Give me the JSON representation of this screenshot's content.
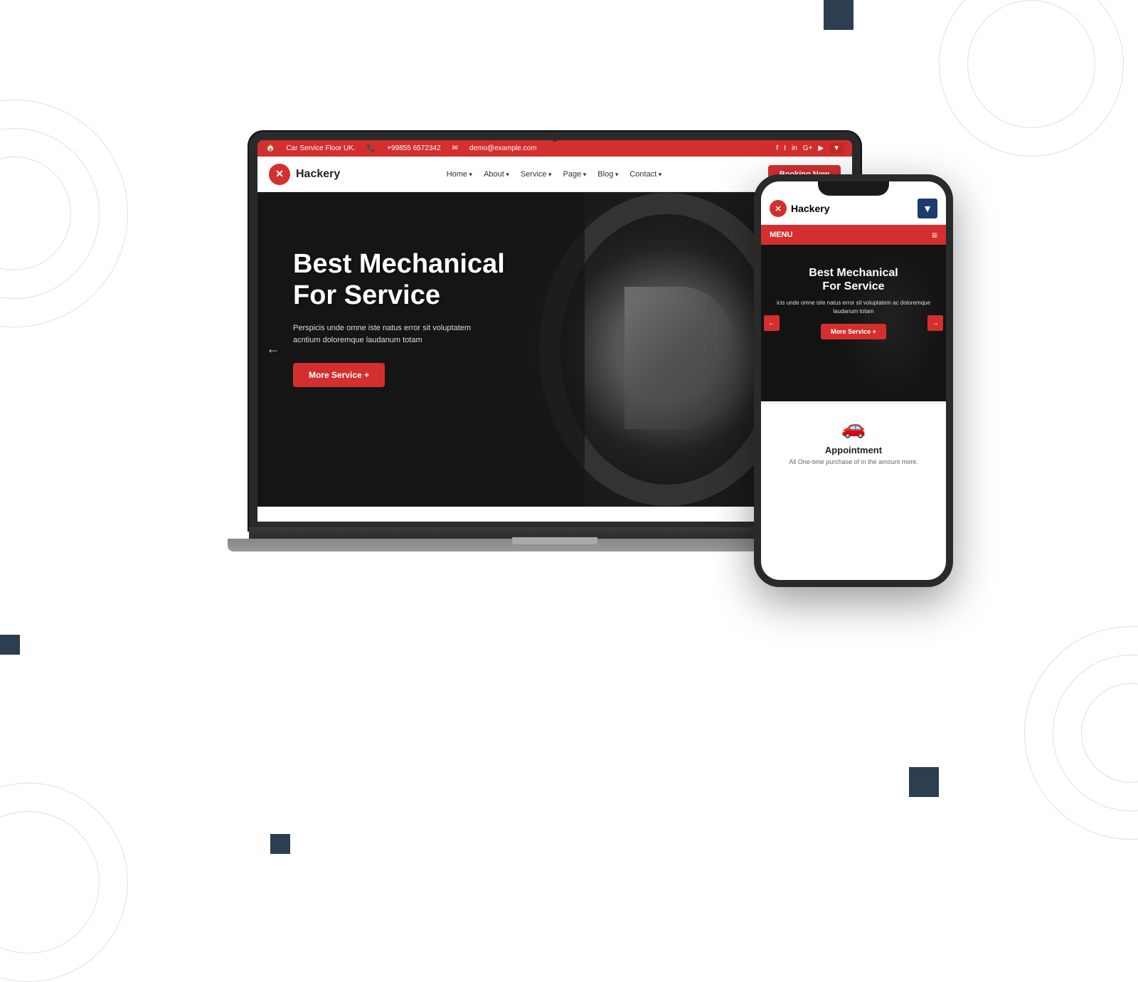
{
  "page": {
    "background": "#ffffff"
  },
  "topbar": {
    "address": "Car Service Floor UK.",
    "phone": "+99855 6572342",
    "email": "demo@example.com",
    "social": [
      "fb",
      "tw",
      "ig",
      "gplus",
      "yt"
    ]
  },
  "nav": {
    "brand": "Hackery",
    "links": [
      {
        "label": "Home",
        "dropdown": true
      },
      {
        "label": "About",
        "dropdown": true
      },
      {
        "label": "Service",
        "dropdown": true
      },
      {
        "label": "Page",
        "dropdown": true
      },
      {
        "label": "Blog",
        "dropdown": true
      },
      {
        "label": "Contact",
        "dropdown": true
      }
    ],
    "booking_btn": "Booking Now"
  },
  "hero": {
    "title_line1": "Best Mechanical",
    "title_line2": "For Service",
    "subtitle": "Perspicis unde omne iste natus error sit voluptatem acntium doloremque laudanum totam",
    "cta_btn": "More Service +",
    "arrow_left": "←",
    "arrow_right": "→"
  },
  "phone": {
    "brand": "Hackery",
    "menu_label": "MENU",
    "hero_title_line1": "Best Mechanical",
    "hero_title_line2": "For Service",
    "hero_text": "icis unde omne iste natus error sit voluptatem ac doloremque laudanum totam",
    "hero_cta": "More Service +",
    "service_title": "Appointment",
    "service_text": "All One-time purchase of in the amount more."
  }
}
